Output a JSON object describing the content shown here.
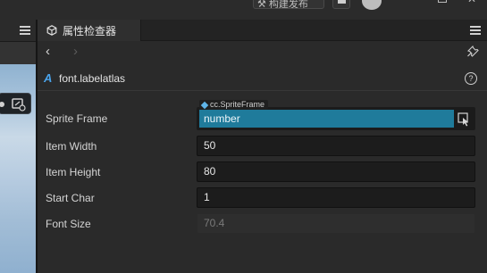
{
  "toolbar": {
    "build_label": "构建发布",
    "build_icon": "hammer-icon",
    "help_icon": "help-circle-icon",
    "maximize_icon": "maximize-icon",
    "close_icon": "close-icon"
  },
  "inspector": {
    "tab_label": "属性检查器",
    "tab_icon": "inspector-icon",
    "asset_title": "font.labelatlas",
    "asset_icon": "label-atlas-icon"
  },
  "properties": {
    "sprite_frame": {
      "label": "Sprite Frame",
      "type_tag": "cc.SpriteFrame",
      "value": "number"
    },
    "item_width": {
      "label": "Item Width",
      "value": "50"
    },
    "item_height": {
      "label": "Item Height",
      "value": "80"
    },
    "start_char": {
      "label": "Start Char",
      "value": "1"
    },
    "font_size": {
      "label": "Font Size",
      "value": "70.4"
    }
  },
  "colors": {
    "accent": "#1f7b9b",
    "asset_icon": "#4aa3ea",
    "background": "#2a2a2a"
  }
}
